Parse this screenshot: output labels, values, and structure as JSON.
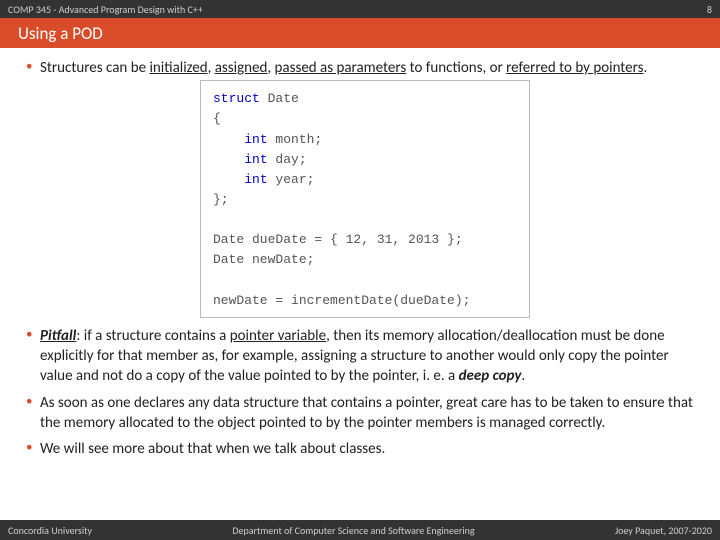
{
  "header": {
    "course": "COMP 345 - Advanced Program Design with C++",
    "slide_number": "8"
  },
  "title": "Using a POD",
  "bullets": {
    "b1": {
      "t1": "Structures can be ",
      "u1": "initialized",
      "t2": ", ",
      "u2": "assigned",
      "t3": ", ",
      "u3": "passed as parameters",
      "t4": " to functions, or ",
      "u4": "referred to by pointers",
      "t5": "."
    },
    "b2": {
      "pitfall": "Pitfall",
      "t1": ": if a structure contains a ",
      "u1": "pointer variable",
      "t2": ", then its memory allocation/deallocation must be done explicitly for that member as, for example, assigning a structure to another would only copy the pointer value and not do a copy of the value pointed to by the pointer, i. e. a ",
      "deep": "deep copy",
      "t3": "."
    },
    "b3": "As soon as one declares any data structure that contains a pointer, great care has to be taken to ensure that the memory allocated to the object pointed to by the pointer members is managed correctly.",
    "b4": "We will see more about that when we talk about classes."
  },
  "code": {
    "kw_struct": "struct",
    "name": " Date",
    "brace_open": "{",
    "kw_int1": "int",
    "m1": " month;",
    "kw_int2": "int",
    "m2": " day;",
    "kw_int3": "int",
    "m3": " year;",
    "brace_close": "};",
    "l1a": "Date dueDate = { 12, 31, 2013 };",
    "l1b": "Date newDate;",
    "l2": "newDate = incrementDate(dueDate);"
  },
  "footer": {
    "left": "Concordia University",
    "center": "Department of Computer Science and Software Engineering",
    "right": "Joey Paquet, 2007-2020"
  }
}
